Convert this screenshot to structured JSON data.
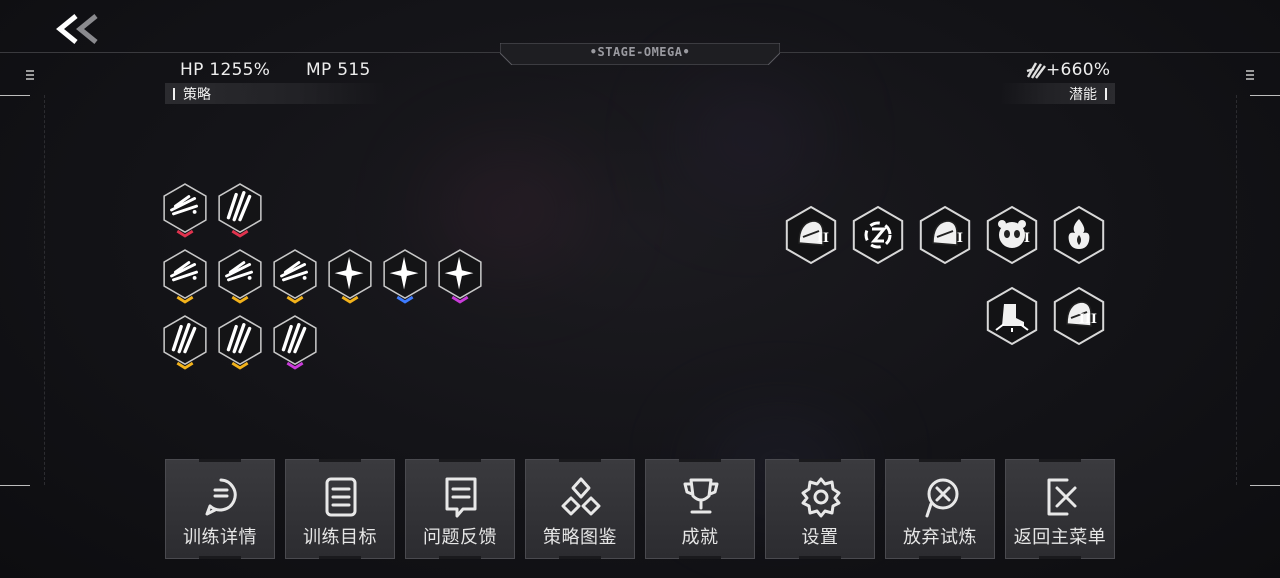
{
  "header": {
    "back_glyph": "<<",
    "stage_title": "•STAGE-OMEGA•"
  },
  "stats": {
    "hp": "HP 1255%",
    "mp": "MP 515",
    "bonus": "+660%"
  },
  "sections": {
    "left_label": "策略",
    "right_label": "潜能"
  },
  "strategy_badges": [
    {
      "icon": "feather-wings-icon",
      "accent": "#e0334e"
    },
    {
      "icon": "claw-slash-icon",
      "accent": "#e0334e"
    },
    {
      "icon": "feather-wings-icon",
      "accent": "#f2b21b"
    },
    {
      "icon": "feather-wings-icon",
      "accent": "#f2b21b"
    },
    {
      "icon": "feather-wings-icon",
      "accent": "#f2b21b"
    },
    {
      "icon": "sparkle-icon",
      "accent": "#f2b21b"
    },
    {
      "icon": "sparkle-icon",
      "accent": "#3d7bff"
    },
    {
      "icon": "sparkle-icon",
      "accent": "#c93bd9"
    },
    {
      "icon": "claw-slash-icon",
      "accent": "#f2b21b"
    },
    {
      "icon": "claw-slash-icon",
      "accent": "#f2b21b"
    },
    {
      "icon": "claw-slash-icon",
      "accent": "#c93bd9"
    }
  ],
  "potential_badges": [
    {
      "icon": "armor-helmet-icon",
      "level": "II"
    },
    {
      "icon": "spin-rune-icon",
      "level": ""
    },
    {
      "icon": "armor-glove-icon",
      "level": "I"
    },
    {
      "icon": "panda-mask-icon",
      "level": "I"
    },
    {
      "icon": "flame-burst-icon",
      "level": ""
    },
    {
      "icon": "boot-impact-icon",
      "level": ""
    },
    {
      "icon": "tech-pod-icon",
      "level": "III"
    }
  ],
  "buttons": [
    {
      "icon": "chat-bubble-icon",
      "label": "训练详情"
    },
    {
      "icon": "clipboard-list-icon",
      "label": "训练目标"
    },
    {
      "icon": "feedback-note-icon",
      "label": "问题反馈"
    },
    {
      "icon": "trefoil-icon",
      "label": "策略图鉴"
    },
    {
      "icon": "trophy-icon",
      "label": "成就"
    },
    {
      "icon": "gear-icon",
      "label": "设置"
    },
    {
      "icon": "give-up-icon",
      "label": "放弃试炼"
    },
    {
      "icon": "exit-door-icon",
      "label": "返回主菜单"
    }
  ],
  "colors": {
    "red": "#e0334e",
    "gold": "#f2b21b",
    "blue": "#3d7bff",
    "purple": "#c93bd9"
  }
}
